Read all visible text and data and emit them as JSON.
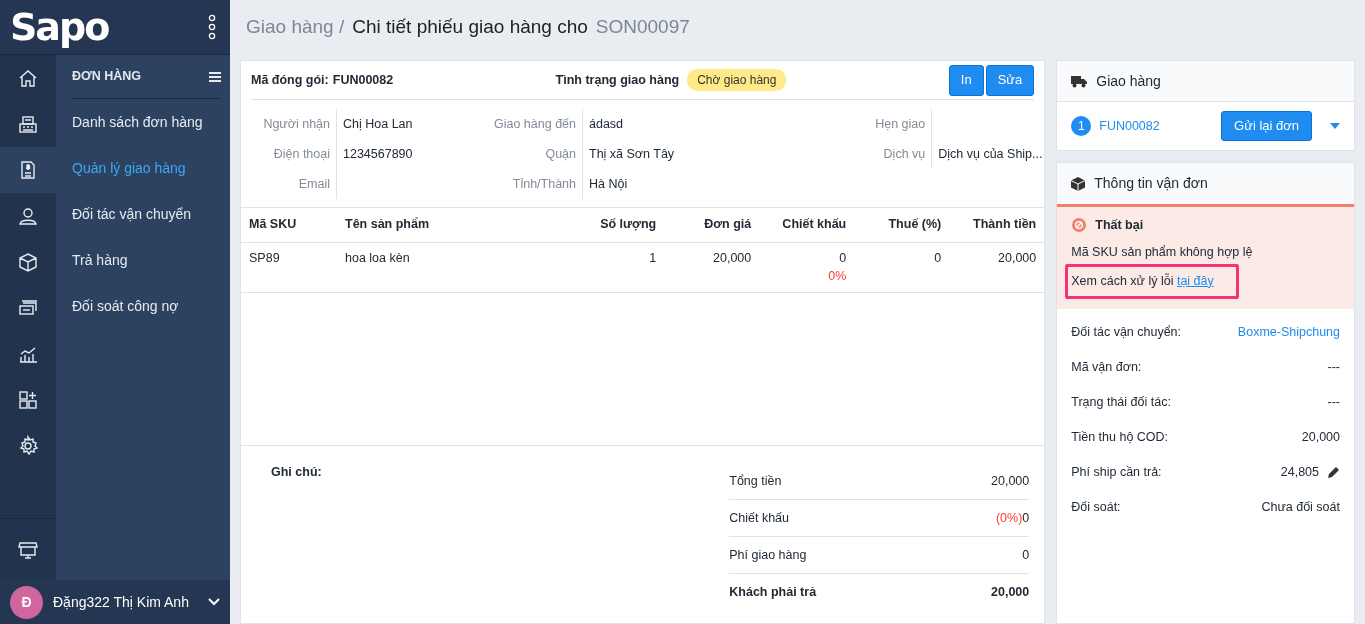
{
  "sidebar": {
    "logo": "Sapo",
    "rail": [
      {
        "selected": false
      },
      {
        "selected": false
      },
      {
        "selected": true
      },
      {
        "selected": false
      },
      {
        "selected": false
      },
      {
        "selected": false
      },
      {
        "selected": false
      },
      {
        "selected": false
      },
      {
        "selected": false
      }
    ],
    "section_title": "ĐƠN HÀNG",
    "menu": [
      {
        "label": "Danh sách đơn hàng",
        "selected": false
      },
      {
        "label": "Quản lý giao hàng",
        "selected": true
      },
      {
        "label": "Đối tác vận chuyển",
        "selected": false
      },
      {
        "label": "Trả hàng",
        "selected": false
      },
      {
        "label": "Đối soát công nợ",
        "selected": false
      }
    ],
    "user": {
      "initial": "Đ",
      "name": "Đặng322 Thị Kim Anh"
    }
  },
  "breadcrumb": {
    "parent": "Giao hàng /",
    "title": "Chi tiết phiếu giao hàng cho",
    "code": "SON00097"
  },
  "package": {
    "code_label": "Mã đóng gói:",
    "code": "FUN00082",
    "status_label": "Tình trạng giao hàng",
    "status": "Chờ giao hàng",
    "buttons": [
      "In",
      "Sửa"
    ],
    "fields": [
      {
        "label": "Người nhận",
        "value": "Chị Hoa Lan"
      },
      {
        "label": "Giao hàng đến",
        "value": "ádasd"
      },
      {
        "label": "Hẹn giao"
      },
      {
        "label": "Điện thoại",
        "value": "1234567890"
      },
      {
        "label": "Quận",
        "value": "Thị xã Sơn Tây"
      },
      {
        "label": "Dịch vụ",
        "value": "Dịch vụ của Ship..."
      },
      {
        "label": "Email"
      },
      {
        "label": "Tỉnh/Thành",
        "value": "Hà Nội"
      }
    ]
  },
  "table": {
    "columns": [
      "Mã SKU",
      "Tên sản phẩm",
      "Số lượng",
      "Đơn giá",
      "Chiết khấu",
      "Thuế (%)",
      "Thành tiền"
    ],
    "rows": [
      {
        "sku": "SP89",
        "name": "hoa loa kèn",
        "qty": "1",
        "price": "20,000",
        "discount": "0",
        "discount_pct": "0%",
        "tax": "0",
        "total": "20,000"
      }
    ]
  },
  "note_label": "Ghi chú:",
  "totals": [
    {
      "label": "Tổng tiền",
      "value": "20,000",
      "bold": false
    },
    {
      "label": "Chiết khấu",
      "prefix": "(0%)",
      "value": "0",
      "bold": false
    },
    {
      "label": "Phí giao hàng",
      "value": "0",
      "bold": false
    },
    {
      "label": "Khách phải trả",
      "value": "20,000",
      "bold": true
    }
  ],
  "delivery": {
    "title": "Giao hàng",
    "step": "1",
    "code": "FUN00082",
    "button": "Gửi lại đơn"
  },
  "shipment": {
    "title": "Thông tin vận đơn",
    "alert": {
      "status": "Thất bại",
      "message": "Mã SKU sản phẩm không hợp lệ",
      "help": "Xem cách xử lý lỗi",
      "link": "tại đây",
      "highlighted": true
    },
    "details": [
      {
        "label": "Đối tác vận chuyển:",
        "value": "Boxme-Shipchung",
        "kind": "link"
      },
      {
        "label": "Mã vận đơn:",
        "value": "---",
        "kind": "text"
      },
      {
        "label": "Trạng thái đối tác:",
        "value": "---",
        "kind": "text"
      },
      {
        "label": "Tiền thu hộ COD:",
        "value": "20,000",
        "kind": "text"
      },
      {
        "label": "Phí ship cần trả:",
        "value": "24,805",
        "kind": "editable"
      },
      {
        "label": "Đối soát:",
        "value": "Chưa đối soát",
        "kind": "text"
      }
    ]
  }
}
